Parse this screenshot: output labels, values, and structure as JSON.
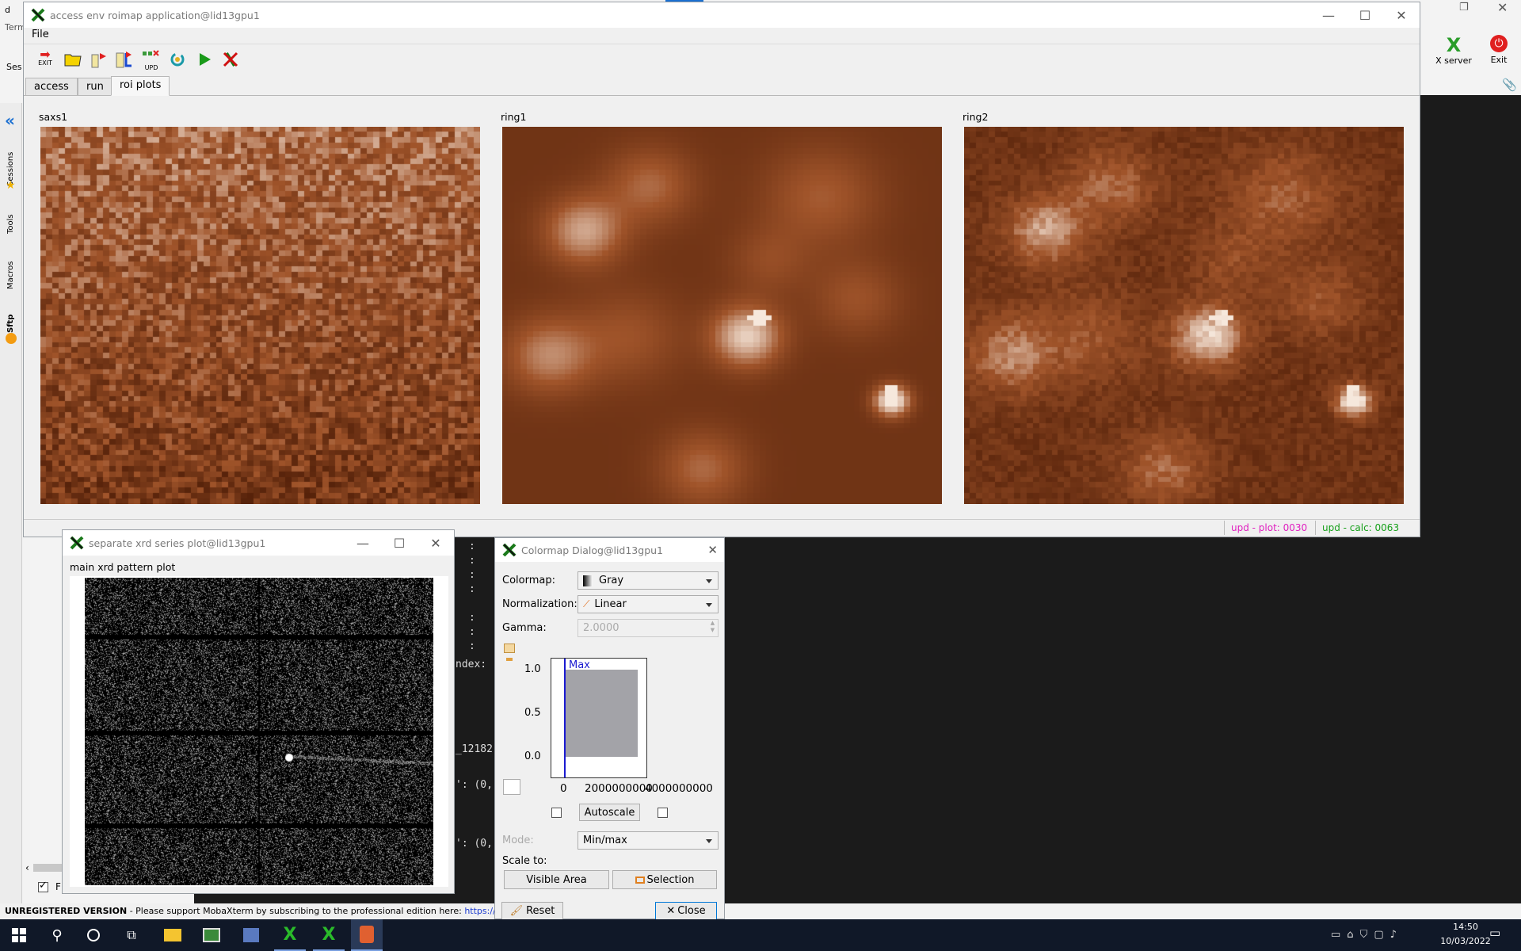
{
  "main_window": {
    "title": "access env roimap application@lid13gpu1",
    "menu": "File",
    "toolbar": {
      "exit": "EXIT",
      "upd": "UPD"
    },
    "tabs": [
      "access",
      "run",
      "roi plots"
    ],
    "active_tab": "roi plots",
    "plots": [
      {
        "label": "saxs1",
        "pattern": "noise"
      },
      {
        "label": "ring1",
        "pattern": "blobs"
      },
      {
        "label": "ring2",
        "pattern": "blobs-noise"
      }
    ],
    "colormap_colors": [
      "#4a1a05",
      "#a0542a",
      "#f6e8dc"
    ],
    "status": {
      "plot": "upd - plot: 0030",
      "calc": "upd - calc: 0063",
      "plot_color": "#e020c0",
      "calc_color": "#16a01a"
    }
  },
  "xrd_window": {
    "title": "separate xrd series plot@lid13gpu1",
    "plot_title": "main xrd pattern plot"
  },
  "colormap_dialog": {
    "title": "Colormap Dialog@lid13gpu1",
    "colormap_label": "Colormap:",
    "colormap_value": "Gray",
    "normalization_label": "Normalization:",
    "normalization_value": "Linear",
    "gamma_label": "Gamma:",
    "gamma_value": "2.0000",
    "histogram": {
      "y_ticks": [
        "1.0",
        "0.5",
        "0.0"
      ],
      "x_ticks": [
        "0",
        "2000000000",
        "4000000000"
      ],
      "max_label": "Max"
    },
    "autoscale_label": "Autoscale",
    "mode_label": "Mode:",
    "mode_value": "Min/max",
    "scale_to_label": "Scale to:",
    "visible_area_label": "Visible Area",
    "selection_label": "Selection",
    "reset_label": "Reset",
    "close_label": "Close"
  },
  "desktop": {
    "right_toolbar": {
      "xserver": "X server",
      "exit": "Exit"
    },
    "sidebar_tabs": [
      "Sessions",
      "Tools",
      "Macros",
      "Sftp"
    ],
    "terminal_lines": [
      ":",
      ":",
      ":",
      ":",
      ":",
      ":",
      ":",
      "ndex:",
      "_12182",
      "': (0,",
      "': (0,"
    ],
    "left_fragments": [
      "d",
      "Term",
      "Ses",
      "F"
    ]
  },
  "footer": {
    "unregistered": "UNREGISTERED VERSION",
    "message": " -  Please support MobaXterm by subscribing to the professional edition here: ",
    "link": "https://mobaxterm.m"
  },
  "taskbar": {
    "time": "14:50",
    "date": "10/03/2022"
  }
}
